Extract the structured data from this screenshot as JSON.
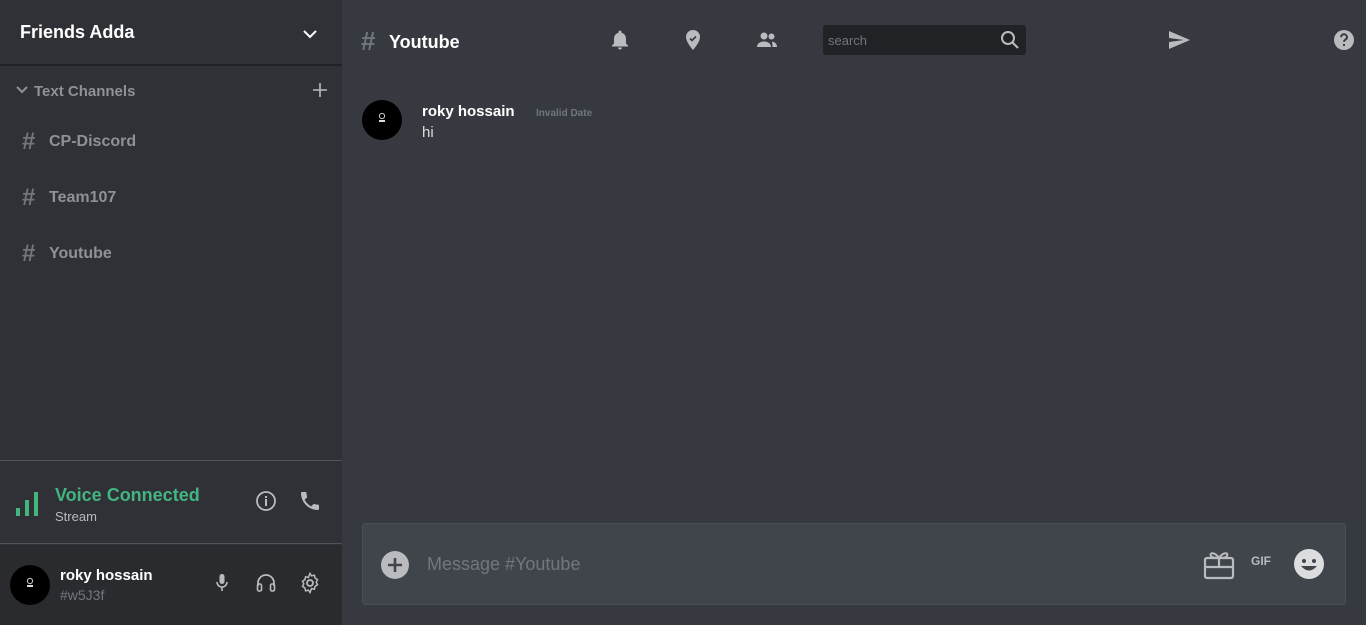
{
  "server": {
    "name": "Friends Adda"
  },
  "sidebar": {
    "category_label": "Text Channels",
    "channel_hash": "#",
    "channels": [
      {
        "label": "CP-Discord"
      },
      {
        "label": "Team107"
      },
      {
        "label": "Youtube"
      }
    ]
  },
  "voice": {
    "status": "Voice Connected",
    "channel": "Stream"
  },
  "user": {
    "name": "roky hossain",
    "tag": "#w5J3f"
  },
  "header": {
    "hash": "#",
    "channel_title": "Youtube",
    "search_placeholder": "search"
  },
  "messages": [
    {
      "author": "roky hossain",
      "timestamp": "Invalid Date",
      "text": "hi"
    }
  ],
  "composer": {
    "placeholder": "Message #Youtube",
    "gif_label": "GIF"
  },
  "colors": {
    "accent_green": "#43b581",
    "sidebar_bg": "#2f3136",
    "main_bg": "#36393f",
    "user_panel_bg": "#292b2f"
  }
}
